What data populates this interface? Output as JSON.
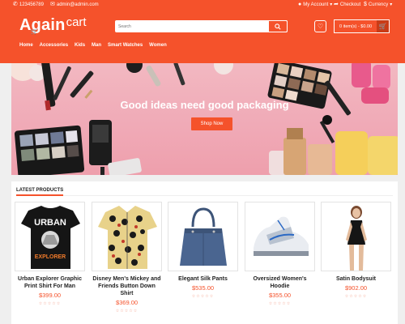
{
  "topbar": {
    "phone": "123456789",
    "email": "admin@admin.com",
    "account": "My Account",
    "checkout": "Checkout",
    "currency": "Currency"
  },
  "logo": {
    "main": "Again",
    "cart": "cart"
  },
  "search": {
    "placeholder": "Search"
  },
  "cart": {
    "label": "0 item(s) - $0.00"
  },
  "nav": [
    "Home",
    "Accessories",
    "Kids",
    "Man",
    "Smart Watches",
    "Women"
  ],
  "banner": {
    "title": "Good ideas need good packaging",
    "button": "Shop Now"
  },
  "products_section": {
    "title": "LATEST PRODUCTS"
  },
  "products": [
    {
      "name": "Urban Explorer Graphic Print Shirt For Man",
      "price": "$399.00",
      "rating": 0,
      "shirt_text_1": "URBAN",
      "shirt_text_2": "EXPLORER"
    },
    {
      "name": "Disney Men's Mickey and Friends Button Down Shirt",
      "price": "$369.00",
      "rating": 0
    },
    {
      "name": "Elegant Silk Pants",
      "price": "$535.00",
      "rating": 0
    },
    {
      "name": "Oversized Women's Hoodie",
      "price": "$355.00",
      "rating": 0
    },
    {
      "name": "Satin Bodysuit",
      "price": "$902.00",
      "rating": 0
    }
  ],
  "colors": {
    "accent": "#f5522b",
    "star": "#f08c72"
  }
}
